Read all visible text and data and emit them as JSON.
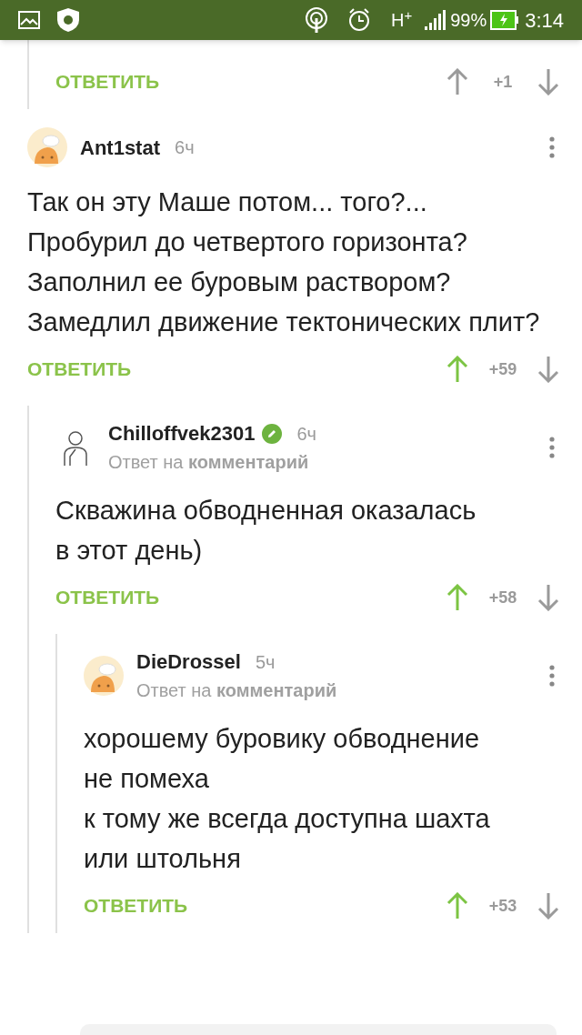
{
  "status_bar": {
    "battery": "99%",
    "time": "3:14",
    "network": "H$^{+}$"
  },
  "comments": [
    {
      "children": [
        {
          "rating": "+1",
          "upvoted": false,
          "reply_label": "ОТВЕТИТЬ"
        }
      ]
    },
    {
      "author": "Ant1stat",
      "time": "6ч",
      "avatar": {
        "kind": "chef"
      },
      "badge": false,
      "text": "Так он эту Маше потом... того?...\nПробурил до четвертого горизонта?\nЗаполнил ее буровым раствором?\nЗамедлил движение тектонических плит?",
      "reply_label": "ОТВЕТИТЬ",
      "rating": "+59",
      "upvoted": true,
      "children": [
        {
          "author": "Chilloffvek2301",
          "time": "6ч",
          "avatar": {
            "kind": "figure"
          },
          "badge": true,
          "reply_to": "Ответ на **комментарий**",
          "text": "Скважина обводненная оказалась\nв этот день)",
          "reply_label": "ОТВЕТИТЬ",
          "rating": "+58",
          "upvoted": true,
          "children": [
            {
              "author": "DieDrossel",
              "time": "5ч",
              "avatar": {
                "kind": "chef"
              },
              "badge": false,
              "reply_to": "Ответ на **комментарий**",
              "text": "хорошему буровику обводнение\nне помеха\nк тому же всегда доступна шахта\nили штольня",
              "reply_label": "ОТВЕТИТЬ",
              "rating": "+53",
              "upvoted": true
            }
          ]
        }
      ]
    }
  ]
}
